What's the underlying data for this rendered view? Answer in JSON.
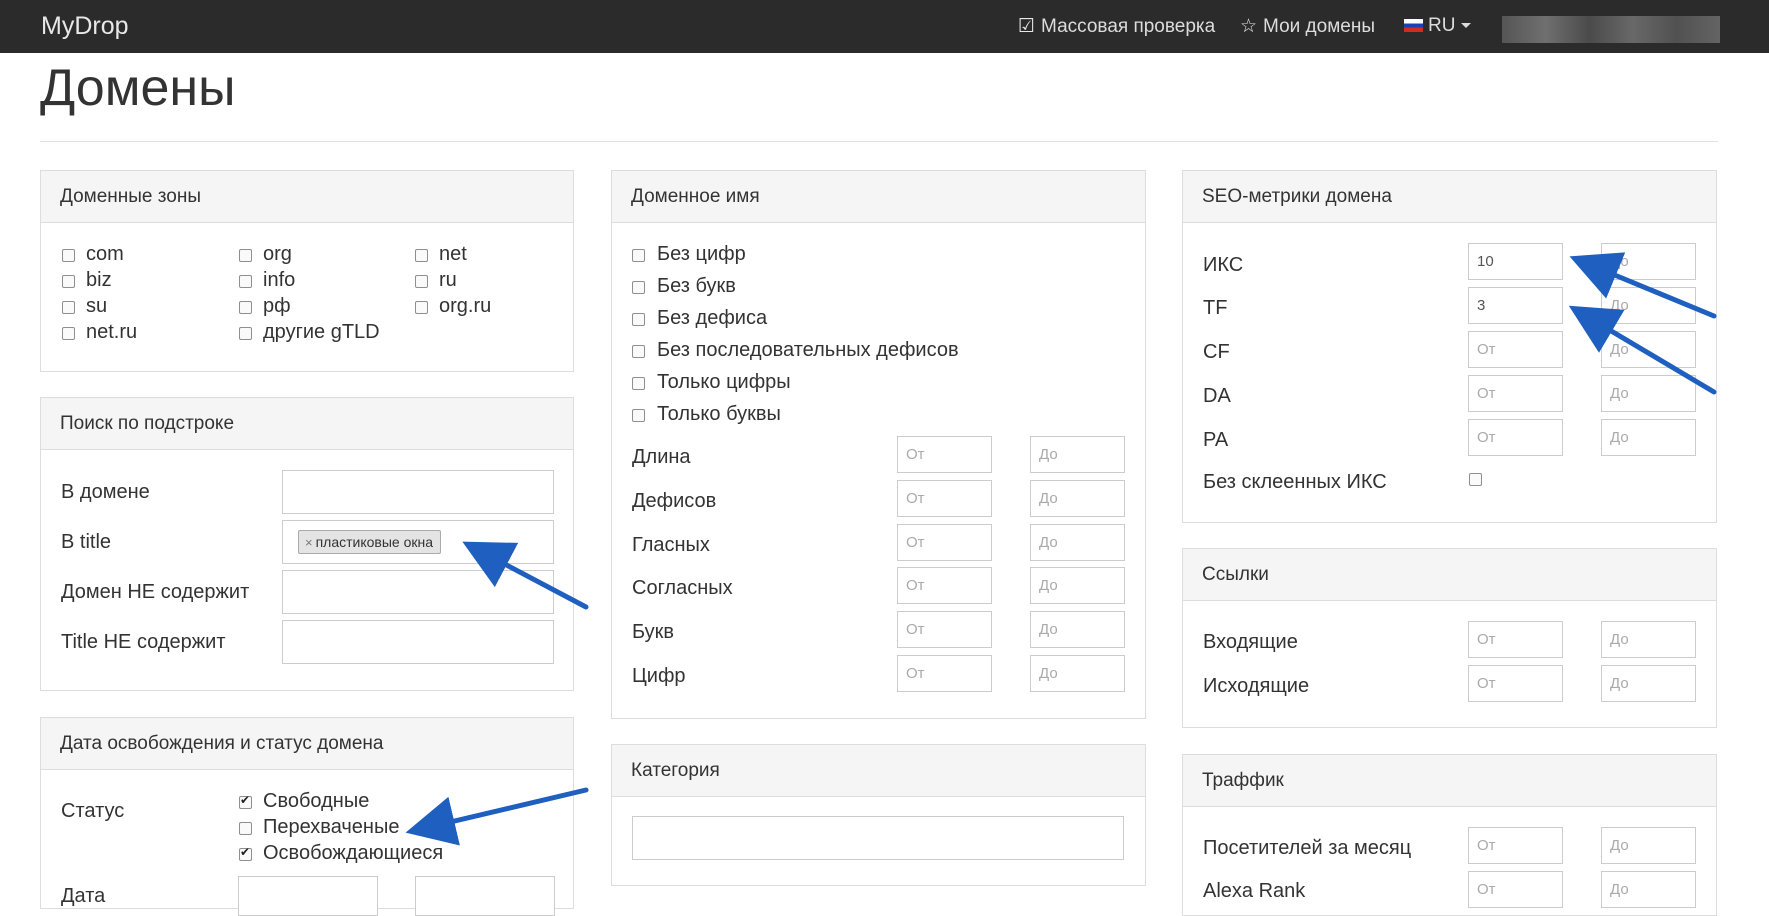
{
  "navbar": {
    "brand": "MyDrop",
    "mass_check": "Массовая проверка",
    "my_domains": "Мои домены",
    "lang": "RU"
  },
  "page": {
    "title": "Домены"
  },
  "zones": {
    "title": "Доменные зоны",
    "items": [
      "com",
      "org",
      "net",
      "biz",
      "info",
      "ru",
      "su",
      "рф",
      "org.ru",
      "net.ru",
      "другие gTLD"
    ]
  },
  "substring": {
    "title": "Поиск по подстроке",
    "in_domain": "В домене",
    "in_title": "В title",
    "title_tag": "пластиковые окна",
    "tag_remove": "×",
    "domain_not": "Домен НЕ содержит",
    "title_not": "Title НЕ содержит"
  },
  "release": {
    "title": "Дата освобождения и статус домена",
    "status_label": "Статус",
    "statuses": [
      {
        "label": "Свободные",
        "checked": true
      },
      {
        "label": "Перехваченые",
        "checked": false
      },
      {
        "label": "Освобождающиеся",
        "checked": true
      }
    ],
    "date_label": "Дата"
  },
  "name": {
    "title": "Доменное имя",
    "checks": [
      "Без цифр",
      "Без букв",
      "Без дефиса",
      "Без последовательных дефисов",
      "Только цифры",
      "Только буквы"
    ],
    "rows": [
      "Длина",
      "Дефисов",
      "Гласных",
      "Согласных",
      "Букв",
      "Цифр"
    ]
  },
  "placeholders": {
    "from": "От",
    "to": "До"
  },
  "category": {
    "title": "Категория"
  },
  "seo": {
    "title": "SEO-метрики домена",
    "rows": [
      {
        "label": "ИКС",
        "from": "10"
      },
      {
        "label": "TF",
        "from": "3"
      },
      {
        "label": "CF",
        "from": ""
      },
      {
        "label": "DA",
        "from": ""
      },
      {
        "label": "PA",
        "from": ""
      }
    ],
    "no_glued": "Без склеенных ИКС"
  },
  "links": {
    "title": "Ссылки",
    "rows": [
      "Входящие",
      "Исходящие"
    ]
  },
  "traffic": {
    "title": "Траффик",
    "rows": [
      "Посетителей за месяц",
      "Alexa Rank"
    ]
  },
  "colors": {
    "navbar": "#2b2b2b",
    "panel_header": "#f5f5f5",
    "arrow": "#1f5fbf"
  },
  "icons": [
    "check-square-icon",
    "star-icon",
    "ru-flag-icon",
    "caret-down-icon",
    "arrow-icon"
  ]
}
